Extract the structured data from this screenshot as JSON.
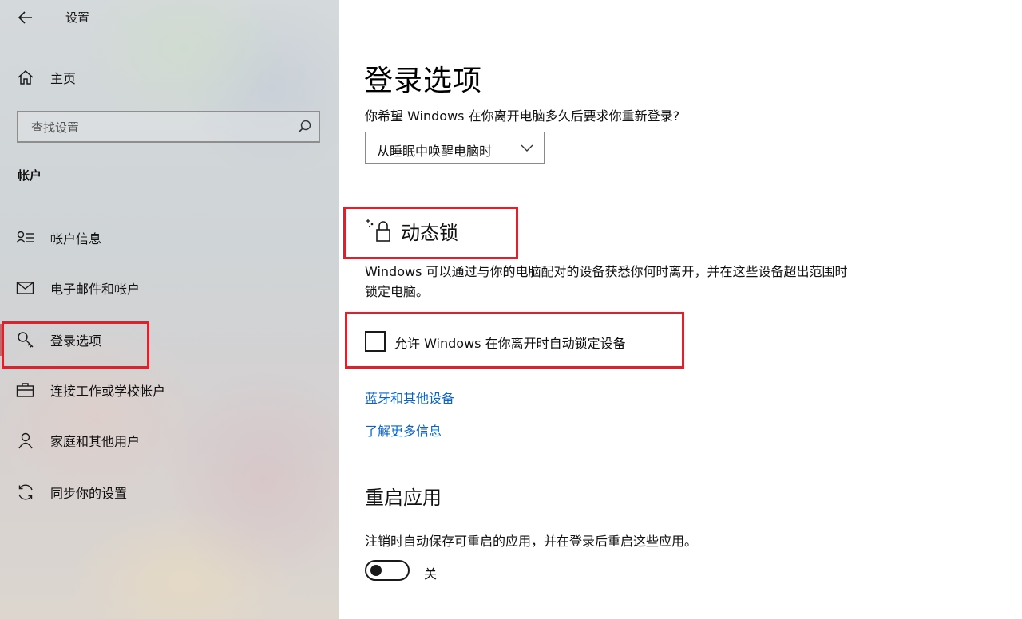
{
  "app": {
    "title": "设置"
  },
  "sidebar": {
    "home_label": "主页",
    "search_placeholder": "查找设置",
    "section_header": "帐户",
    "items": [
      {
        "label": "帐户信息",
        "icon": "account-info-icon"
      },
      {
        "label": "电子邮件和帐户",
        "icon": "mail-icon"
      },
      {
        "label": "登录选项",
        "icon": "key-icon",
        "active": true
      },
      {
        "label": "连接工作或学校帐户",
        "icon": "briefcase-icon"
      },
      {
        "label": "家庭和其他用户",
        "icon": "person-icon"
      },
      {
        "label": "同步你的设置",
        "icon": "sync-icon"
      }
    ]
  },
  "main": {
    "page_title": "登录选项",
    "question": "你希望 Windows 在你离开电脑多久后要求你重新登录?",
    "dropdown_value": "从睡眠中唤醒电脑时",
    "dynamic_lock": {
      "title": "动态锁",
      "description": "Windows 可以通过与你的电脑配对的设备获悉你何时离开，并在这些设备超出范围时锁定电脑。",
      "checkbox_label": "允许 Windows 在你离开时自动锁定设备",
      "checkbox_checked": false
    },
    "links": {
      "bluetooth": "蓝牙和其他设备",
      "learn_more": "了解更多信息"
    },
    "restart_apps": {
      "title": "重启应用",
      "description": "注销时自动保存可重启的应用，并在登录后重启这些应用。",
      "toggle_state": "关",
      "toggle_on": false
    }
  },
  "colors": {
    "highlight_box": "#e0202a",
    "link": "#0a64c8",
    "active_indicator": "#c0686a"
  }
}
